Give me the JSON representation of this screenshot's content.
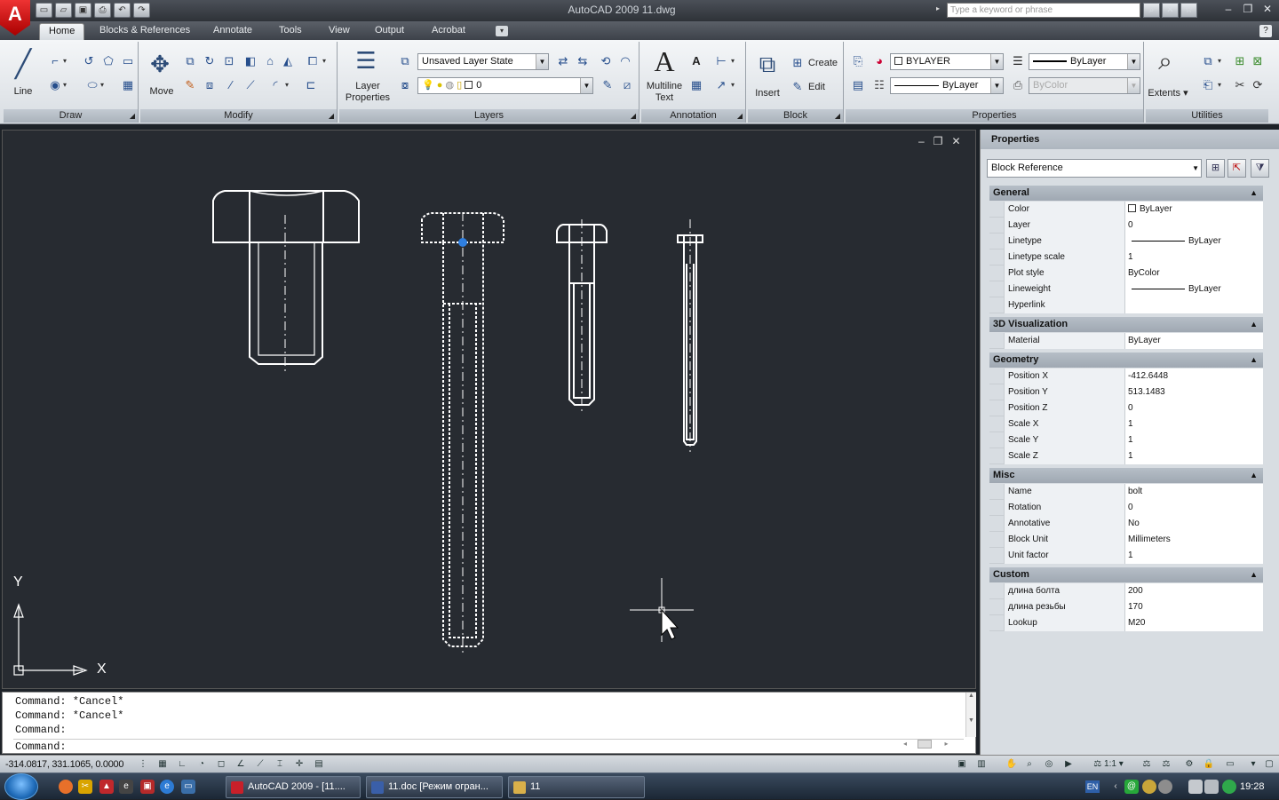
{
  "app": {
    "title": "AutoCAD 2009  11.dwg",
    "logo": "A",
    "search_placeholder": "Type a keyword or phrase"
  },
  "quick_access": [
    "new-icon",
    "open-icon",
    "save-icon",
    "print-icon",
    "undo-icon",
    "redo-icon"
  ],
  "ribbon_tabs": [
    "Home",
    "Blocks & References",
    "Annotate",
    "Tools",
    "View",
    "Output",
    "Acrobat"
  ],
  "panels": {
    "draw": {
      "label": "Draw",
      "line_label": "Line"
    },
    "modify": {
      "label": "Modify",
      "move_label": "Move"
    },
    "layers": {
      "label": "Layers",
      "layer_properties_label": "Layer Properties",
      "layer_state": "Unsaved Layer State",
      "current_layer": "0"
    },
    "annotation": {
      "label": "Annotation",
      "mtext_label": "Multiline Text"
    },
    "block": {
      "label": "Block",
      "insert_label": "Insert",
      "create_label": "Create",
      "edit_label": "Edit"
    },
    "properties": {
      "label": "Properties",
      "color": "BYLAYER",
      "linetype": "ByLayer",
      "lineweight": "ByLayer",
      "plotstyle": "ByColor"
    },
    "utilities": {
      "label": "Utilities",
      "extents_label": "Extents"
    }
  },
  "properties_palette": {
    "title": "Properties",
    "selection": "Block Reference",
    "groups": [
      {
        "name": "General",
        "rows": [
          {
            "k": "Color",
            "v": "ByLayer",
            "swatch": true
          },
          {
            "k": "Layer",
            "v": "0"
          },
          {
            "k": "Linetype",
            "v": "ByLayer",
            "line": true
          },
          {
            "k": "Linetype scale",
            "v": "1"
          },
          {
            "k": "Plot style",
            "v": "ByColor"
          },
          {
            "k": "Lineweight",
            "v": "ByLayer",
            "line": true
          },
          {
            "k": "Hyperlink",
            "v": ""
          }
        ]
      },
      {
        "name": "3D Visualization",
        "rows": [
          {
            "k": "Material",
            "v": "ByLayer"
          }
        ]
      },
      {
        "name": "Geometry",
        "rows": [
          {
            "k": "Position X",
            "v": "-412.6448"
          },
          {
            "k": "Position Y",
            "v": "513.1483"
          },
          {
            "k": "Position Z",
            "v": "0"
          },
          {
            "k": "Scale X",
            "v": "1"
          },
          {
            "k": "Scale Y",
            "v": "1"
          },
          {
            "k": "Scale Z",
            "v": "1"
          }
        ]
      },
      {
        "name": "Misc",
        "rows": [
          {
            "k": "Name",
            "v": "bolt"
          },
          {
            "k": "Rotation",
            "v": "0"
          },
          {
            "k": "Annotative",
            "v": "No"
          },
          {
            "k": "Block Unit",
            "v": "Millimeters"
          },
          {
            "k": "Unit factor",
            "v": "1"
          }
        ]
      },
      {
        "name": "Custom",
        "rows": [
          {
            "k": "длина болта",
            "v": "200"
          },
          {
            "k": "длина резьбы",
            "v": "170"
          },
          {
            "k": "Lookup",
            "v": "M20"
          }
        ]
      }
    ]
  },
  "ucs": {
    "x_label": "X",
    "y_label": "Y"
  },
  "command_lines": [
    "Command:  *Cancel*",
    "Command:  *Cancel*",
    "Command:",
    "Command:"
  ],
  "status": {
    "coords": "-314.0817, 331.1065, 0.0000",
    "annotation_scale": "1:1"
  },
  "taskbar": {
    "tasks": [
      "AutoCAD 2009 - [11....",
      "11.doc [Режим огран...",
      "11"
    ],
    "lang": "EN",
    "clock": "19:28"
  },
  "colors": {
    "canvas": "#272b31",
    "grip": "#2f7fe0",
    "ribbon": "#dfe3e8"
  }
}
